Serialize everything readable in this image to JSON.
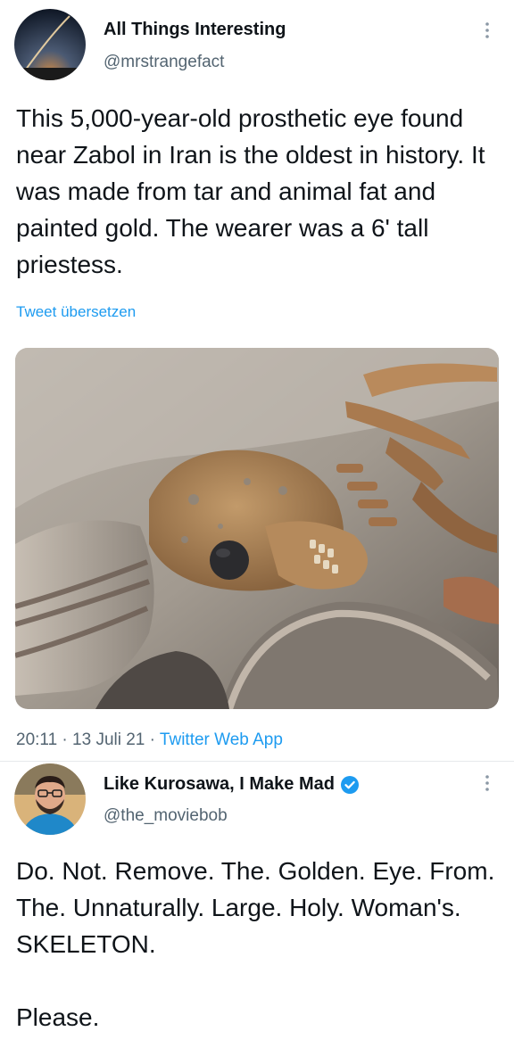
{
  "tweet1": {
    "author_name": "All Things Interesting",
    "author_handle": "@mrstrangefact",
    "text": "This 5,000-year-old prosthetic eye found near Zabol in Iran is the oldest in history. It was made from tar and animal fat and painted gold. The wearer was a 6' tall priestess.",
    "translate_label": "Tweet übersetzen",
    "time": "20:11",
    "date": "13 Juli 21",
    "separator": "·",
    "source": "Twitter Web App",
    "more_icon": "more-vertical-icon"
  },
  "tweet2": {
    "author_name": "Like Kurosawa, I Make Mad",
    "author_handle": "@the_moviebob",
    "verified_icon": "verified-badge-icon",
    "verified_color": "#1d9bf0",
    "text_line1": "Do. Not. Remove. The. Golden. Eye. From. The. Unnaturally. Large. Holy. Woman's. SKELETON.",
    "text_line2": "Please.",
    "more_icon": "more-vertical-icon"
  },
  "colors": {
    "link": "#1d9bf0",
    "secondary": "#536471",
    "primary": "#0f1419"
  }
}
